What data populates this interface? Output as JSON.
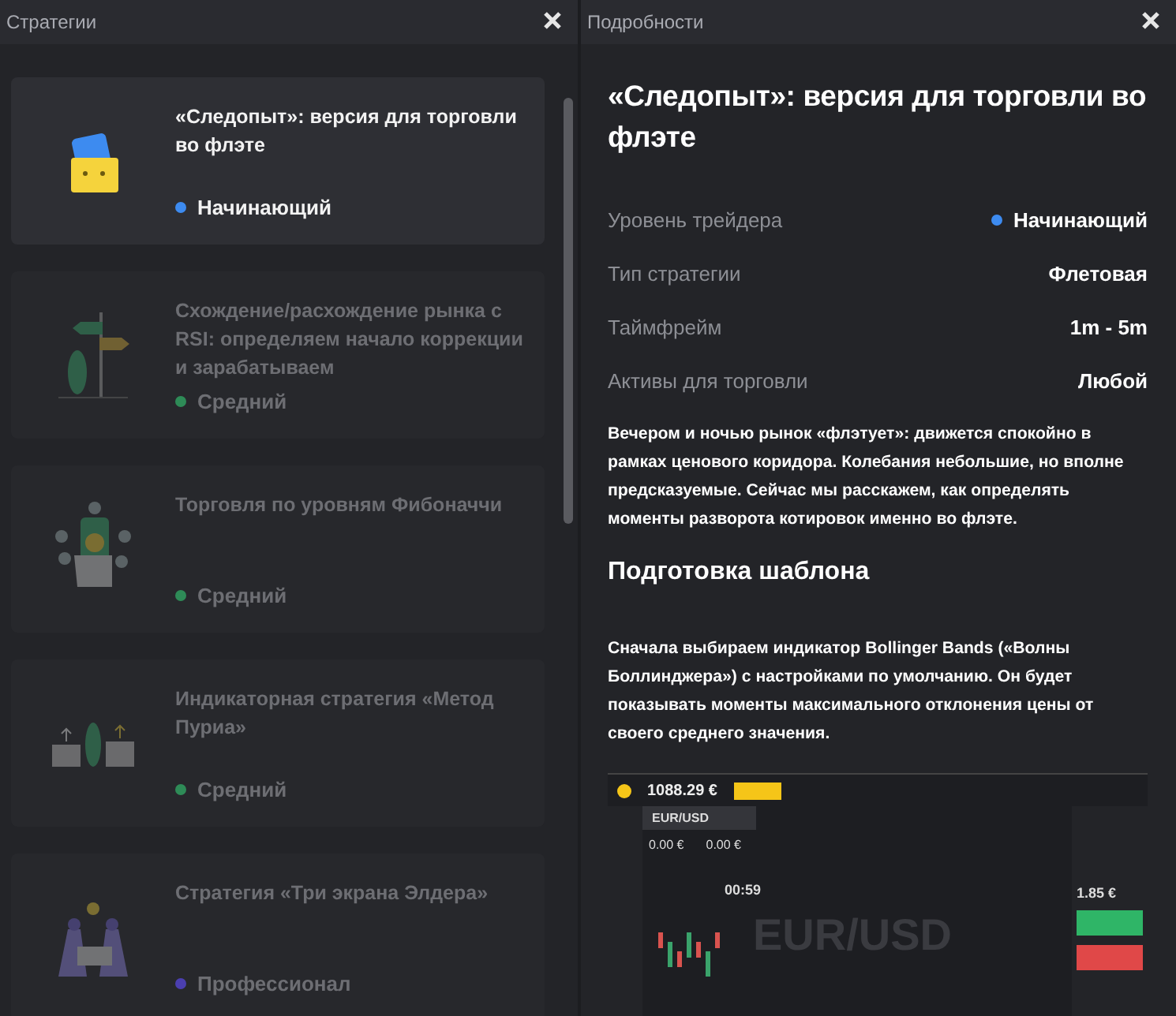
{
  "strategies_panel": {
    "title": "Стратегии",
    "items": [
      {
        "title": "«Следопыт»: версия для торговли во флэте",
        "level": "Начинающий",
        "color": "#3d8bf0",
        "selected": true,
        "kind": "wallet"
      },
      {
        "title": "Схождение/расхождение рынка с RSI: определяем начало коррекции и зарабатываем",
        "level": "Средний",
        "color": "#2e8b57",
        "selected": false,
        "kind": "signpost"
      },
      {
        "title": "Торговля по уровням Фибоначчи",
        "level": "Средний",
        "color": "#2e8b57",
        "selected": false,
        "kind": "phone"
      },
      {
        "title": "Индикаторная стратегия «Метод Пуриа»",
        "level": "Средний",
        "color": "#2e8b57",
        "selected": false,
        "kind": "scales"
      },
      {
        "title": "Стратегия «Три экрана Элдера»",
        "level": "Профессионал",
        "color": "#4b3fb0",
        "selected": false,
        "kind": "team"
      }
    ]
  },
  "details_panel": {
    "title": "Подробности",
    "heading": "«Следопыт»: версия для торговли во флэте",
    "properties": [
      {
        "label": "Уровень трейдера",
        "value": "Начинающий",
        "color": "#3d8bf0"
      },
      {
        "label": "Тип стратегии",
        "value": "Флетовая"
      },
      {
        "label": "Таймфрейм",
        "value": "1m - 5m"
      },
      {
        "label": "Активы для торговли",
        "value": "Любой"
      }
    ],
    "intro": "Вечером и ночью рынок «флэтует»: движется спокойно в рамках ценового коридора. Колебания небольшие, но вполне предсказуемые. Сейчас мы расскажем, как определять моменты разворота котировок именно во флэте.",
    "section_heading": "Подготовка шаблона",
    "section_text": "Сначала выбираем индикатор Bollinger Bands («Волны Боллинджера») с настройками по умолчанию. Он будет показывать моменты максимального отклонения цены от своего среднего значения.",
    "screenshot": {
      "balance": "1088.29 €",
      "tab": "EUR/USD",
      "invested": "0.00 €",
      "income": "0.00 €",
      "timer": "00:59",
      "watermark": "EUR/USD",
      "payout": "1.85 €"
    }
  }
}
